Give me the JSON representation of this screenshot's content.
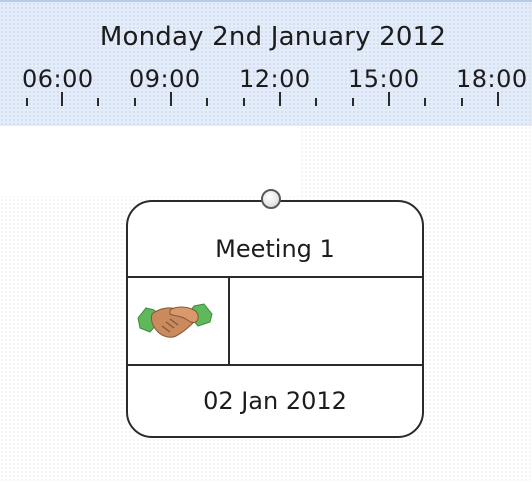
{
  "timeline": {
    "date_label": "Monday 2nd January 2012",
    "hours": [
      "06:00",
      "09:00",
      "12:00",
      "15:00",
      "18:00"
    ]
  },
  "event_card": {
    "title": "Meeting 1",
    "date": "02 Jan 2012",
    "icon": "handshake-icon"
  },
  "colors": {
    "timeline_bg": "#e3ecf8",
    "card_border": "#2b2b2b"
  }
}
